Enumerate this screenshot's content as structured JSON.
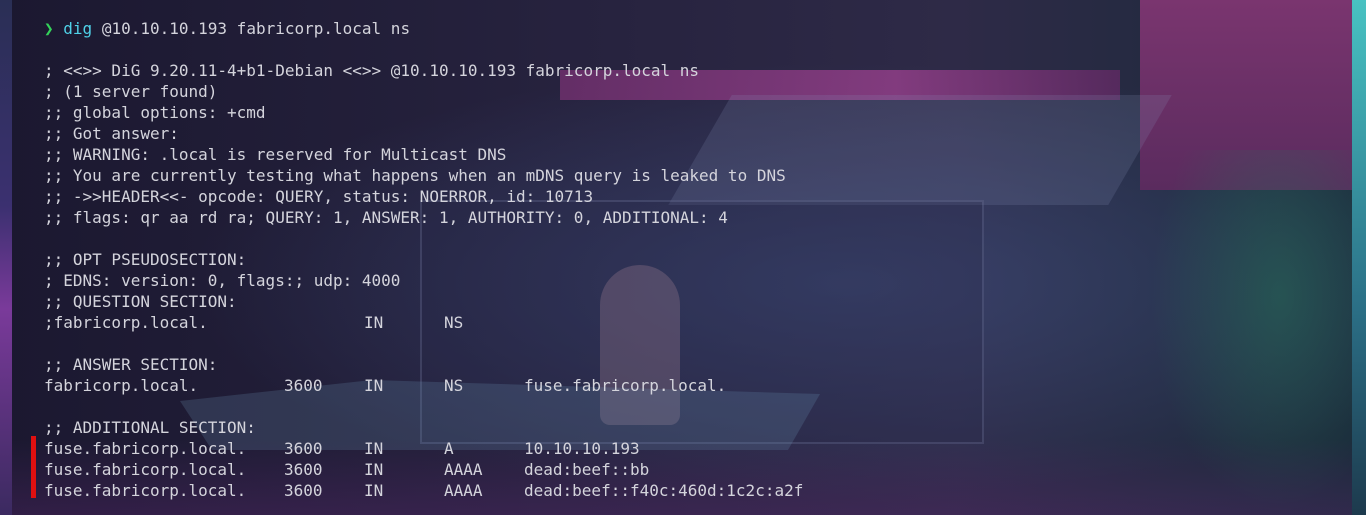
{
  "prompt": {
    "symbol": "❯",
    "command": "dig",
    "args": " @10.10.10.193 fabricorp.local ns"
  },
  "output": {
    "header_lines": [
      "; <<>> DiG 9.20.11-4+b1-Debian <<>> @10.10.10.193 fabricorp.local ns",
      "; (1 server found)",
      ";; global options: +cmd",
      ";; Got answer:",
      ";; WARNING: .local is reserved for Multicast DNS",
      ";; You are currently testing what happens when an mDNS query is leaked to DNS",
      ";; ->>HEADER<<- opcode: QUERY, status: NOERROR, id: 10713",
      ";; flags: qr aa rd ra; QUERY: 1, ANSWER: 1, AUTHORITY: 0, ADDITIONAL: 4"
    ],
    "opt_section": {
      "title": ";; OPT PSEUDOSECTION:",
      "edns": "; EDNS: version: 0, flags:; udp: 4000"
    },
    "question_section": {
      "title": ";; QUESTION SECTION:",
      "row": {
        "name": ";fabricorp.local.",
        "class": "IN",
        "type": "NS"
      }
    },
    "answer_section": {
      "title": ";; ANSWER SECTION:",
      "row": {
        "name": "fabricorp.local.",
        "ttl": "3600",
        "class": "IN",
        "type": "NS",
        "data": "fuse.fabricorp.local."
      }
    },
    "additional_section": {
      "title": ";; ADDITIONAL SECTION:",
      "rows": [
        {
          "name": "fuse.fabricorp.local.",
          "ttl": "3600",
          "class": "IN",
          "type": "A",
          "data": "10.10.10.193"
        },
        {
          "name": "fuse.fabricorp.local.",
          "ttl": "3600",
          "class": "IN",
          "type": "AAAA",
          "data": "dead:beef::bb"
        },
        {
          "name": "fuse.fabricorp.local.",
          "ttl": "3600",
          "class": "IN",
          "type": "AAAA",
          "data": "dead:beef::f40c:460d:1c2c:a2f"
        }
      ]
    }
  },
  "colors": {
    "prompt_arrow": "#34d35a",
    "command": "#4fd1e8",
    "text": "#d4d4dc",
    "marker": "#e01010"
  }
}
